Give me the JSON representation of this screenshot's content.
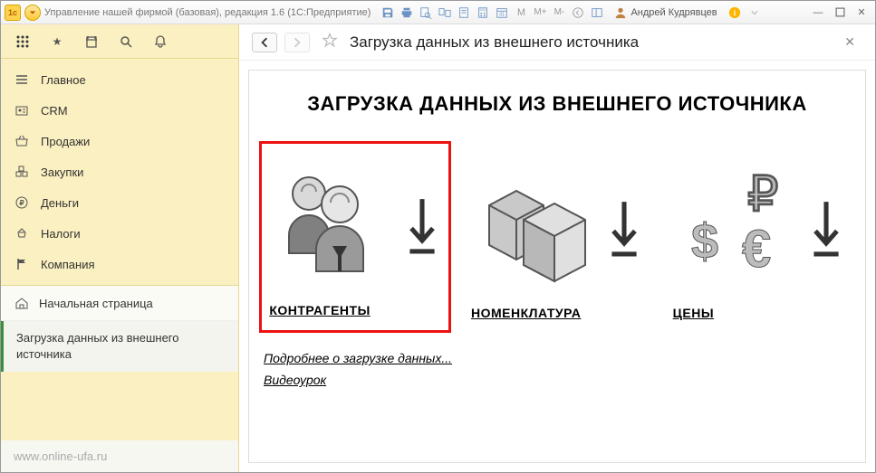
{
  "titlebar": {
    "title": "Управление нашей фирмой (базовая), редакция 1.6  (1С:Предприятие)",
    "user": "Андрей Кудрявцев"
  },
  "sidebar": {
    "items": [
      {
        "label": "Главное"
      },
      {
        "label": "CRM"
      },
      {
        "label": "Продажи"
      },
      {
        "label": "Закупки"
      },
      {
        "label": "Деньги"
      },
      {
        "label": "Налоги"
      },
      {
        "label": "Компания"
      }
    ],
    "home": "Начальная страница",
    "current_page": "Загрузка данных из внешнего источника",
    "footer": "www.online-ufa.ru"
  },
  "main": {
    "header_title": "Загрузка данных из внешнего источника",
    "board_title": "ЗАГРУЗКА ДАННЫХ ИЗ ВНЕШНЕГО ИСТОЧНИКА",
    "tiles": [
      {
        "label": "КОНТРАГЕНТЫ"
      },
      {
        "label": "НОМЕНКЛАТУРА"
      },
      {
        "label": "ЦЕНЫ"
      }
    ],
    "links": {
      "more": "Подробнее о загрузке данных...",
      "video": "Видеоурок"
    }
  }
}
